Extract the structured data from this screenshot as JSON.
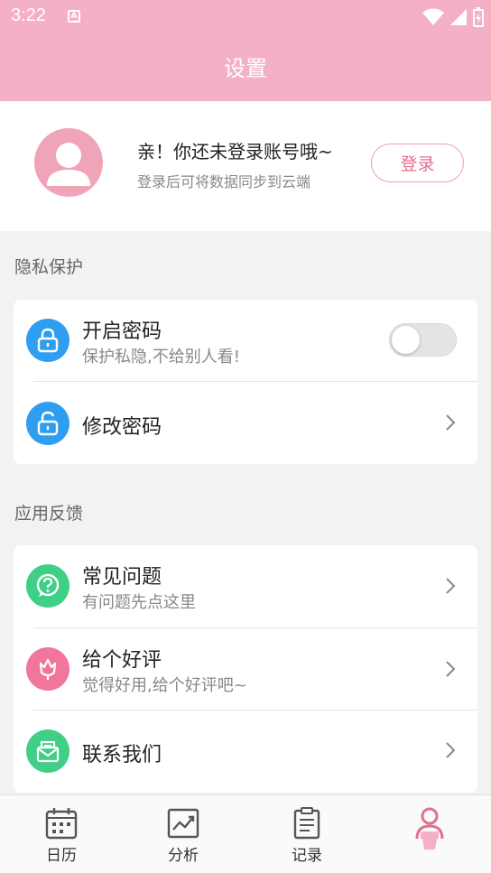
{
  "status_bar": {
    "time": "3:22",
    "notification_icon": "A"
  },
  "header": {
    "title": "设置"
  },
  "profile": {
    "greeting": "亲！你还未登录账号哦~",
    "hint": "登录后可将数据同步到云端",
    "login_label": "登录"
  },
  "privacy": {
    "title": "隐私保护",
    "items": [
      {
        "label": "开启密码",
        "sub": "保护私隐,不给别人看!",
        "toggle": false
      },
      {
        "label": "修改密码"
      }
    ]
  },
  "feedback": {
    "title": "应用反馈",
    "items": [
      {
        "label": "常见问题",
        "sub": "有问题先点这里"
      },
      {
        "label": "给个好评",
        "sub": "觉得好用,给个好评吧~"
      },
      {
        "label": "联系我们"
      }
    ]
  },
  "bottom_nav": [
    {
      "label": "日历",
      "icon": "calendar-icon"
    },
    {
      "label": "分析",
      "icon": "chart-icon"
    },
    {
      "label": "记录",
      "icon": "notes-icon"
    },
    {
      "label": "",
      "icon": "profile-icon"
    }
  ],
  "colors": {
    "header_bg": "#f3b0c6",
    "accent_pink": "#e2708f",
    "lock_blue": "#2f9ef0",
    "help_green": "#3fcf86",
    "rate_pink": "#f0769a"
  }
}
